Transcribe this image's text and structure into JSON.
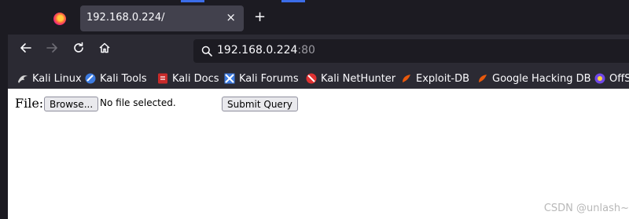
{
  "tab": {
    "title": "192.168.0.224/",
    "close": "×"
  },
  "new_tab": "+",
  "url": {
    "host": "192.168.0.224",
    "port": ":80"
  },
  "bookmarks": [
    {
      "label": "Kali Linux",
      "icon": "kali-dragon-icon",
      "color": "#d6d6d6"
    },
    {
      "label": "Kali Tools",
      "icon": "kali-tools-icon",
      "color": "#3d7be0"
    },
    {
      "label": "Kali Docs",
      "icon": "kali-docs-icon",
      "color": "#c92a2a"
    },
    {
      "label": "Kali Forums",
      "icon": "kali-forums-icon",
      "color": "#3d7be0"
    },
    {
      "label": "Kali NetHunter",
      "icon": "kali-nethunter-icon",
      "color": "#e03131"
    },
    {
      "label": "Exploit-DB",
      "icon": "exploit-db-icon",
      "color": "#e8590c"
    },
    {
      "label": "Google Hacking DB",
      "icon": "ghdb-icon",
      "color": "#e8590c"
    },
    {
      "label": "OffS",
      "icon": "offsec-icon",
      "color": "#7048e8"
    }
  ],
  "form": {
    "label": "File:",
    "browse": "Browse...",
    "no_file": "No file selected.",
    "submit": "Submit Query"
  },
  "watermark": "CSDN @unlash~"
}
